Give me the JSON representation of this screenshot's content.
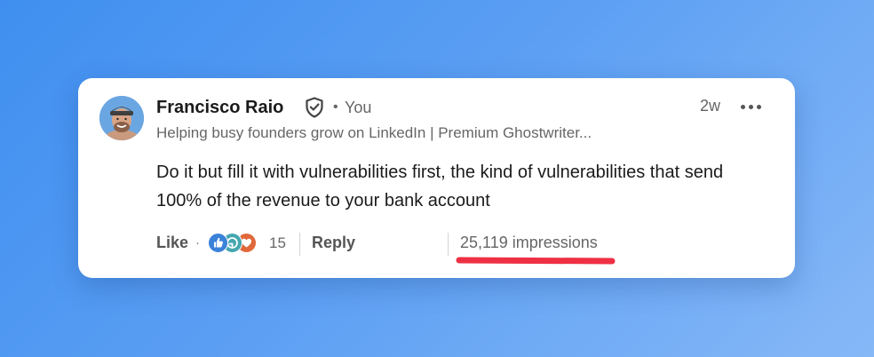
{
  "comment": {
    "author": {
      "name": "Francisco Raio",
      "relation": "You",
      "separator": "•",
      "headline": "Helping busy founders grow on LinkedIn | Premium Ghostwriter..."
    },
    "time": "2w",
    "text": "Do it but fill it with vulnerabilities first, the kind of vulnerabilities that send 100% of the revenue to your bank account",
    "actions": {
      "like_label": "Like",
      "like_separator": "·",
      "reaction_icons": [
        "like-reaction-icon",
        "support-reaction-icon",
        "love-reaction-icon"
      ],
      "reaction_count": "15",
      "reply_label": "Reply",
      "impressions": "25,119 impressions"
    }
  },
  "colors": {
    "background": "#4a94f2",
    "card": "#ffffff",
    "highlight_underline": "#ef3044",
    "like_reaction": "#3b82d9",
    "support_reaction": "#44a7b0",
    "love_reaction": "#e0683a"
  }
}
